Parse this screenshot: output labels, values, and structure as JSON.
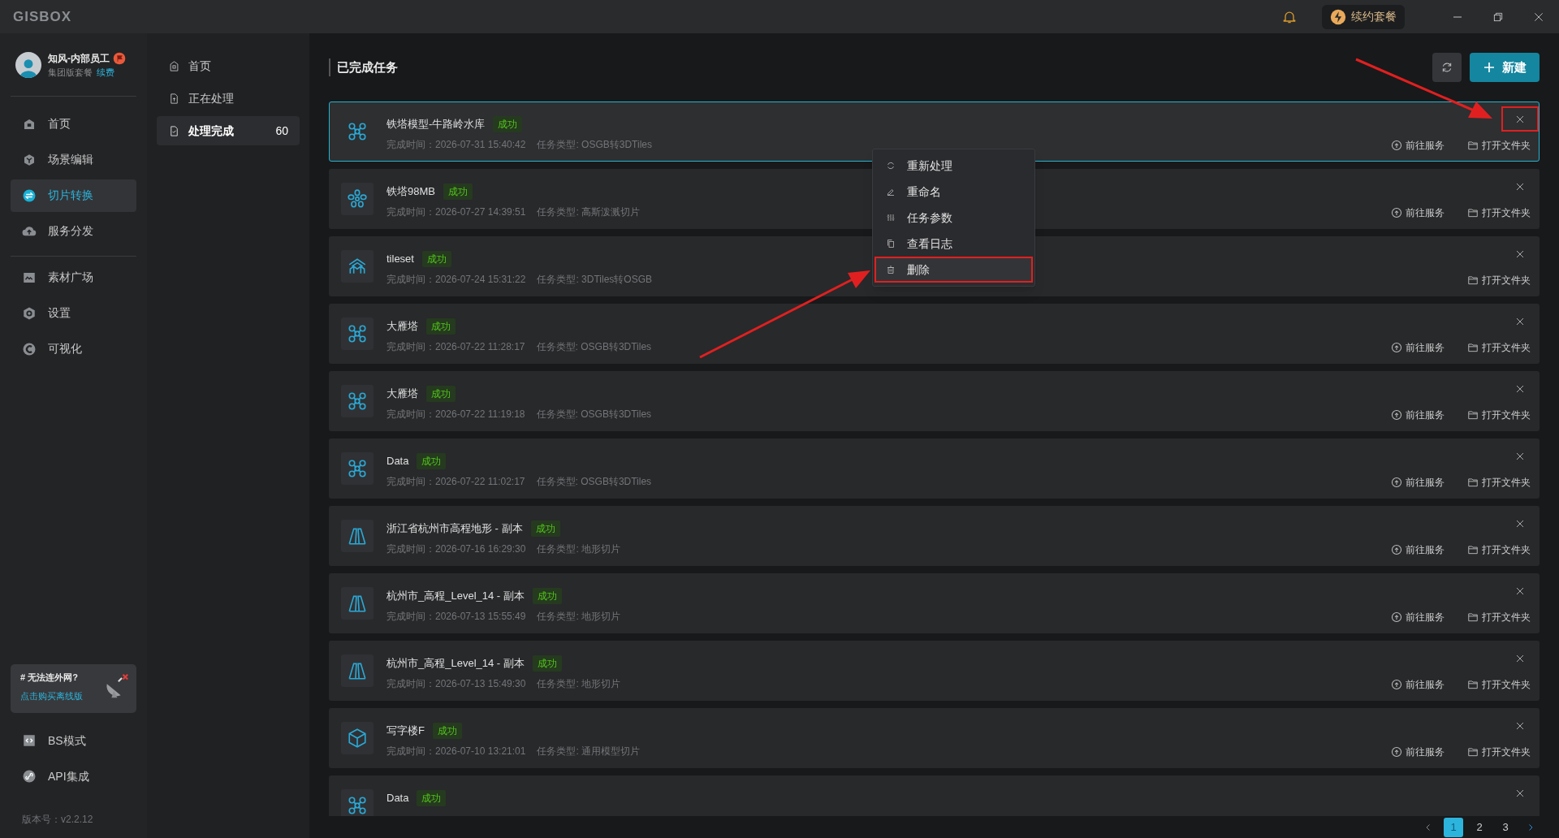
{
  "app": {
    "logo": "GISBOX",
    "renew_button": "续约套餐"
  },
  "user": {
    "name": "知风-内部员工",
    "plan": "集团版套餐",
    "renew_link": "续费"
  },
  "nav_groups": [
    {
      "items": [
        {
          "label": "首页",
          "selected": false
        },
        {
          "label": "场景编辑",
          "selected": false
        },
        {
          "label": "切片转换",
          "selected": true
        },
        {
          "label": "服务分发",
          "selected": false
        }
      ]
    },
    {
      "items": [
        {
          "label": "素材广场",
          "selected": false
        },
        {
          "label": "设置",
          "selected": false
        },
        {
          "label": "可视化",
          "selected": false
        }
      ]
    }
  ],
  "promo": {
    "title": "# 无法连外网?",
    "link": "点击购买离线版"
  },
  "bottom_nav": [
    {
      "label": "BS模式"
    },
    {
      "label": "API集成"
    }
  ],
  "version": "版本号：v2.2.12",
  "sub_nav": [
    {
      "label": "首页",
      "selected": false
    },
    {
      "label": "正在处理",
      "selected": false
    },
    {
      "label": "处理完成",
      "selected": true,
      "count": "60"
    }
  ],
  "page_title": "已完成任务",
  "new_button": "新建",
  "tasks": [
    {
      "name": "铁塔模型-牛路岭水库",
      "status": "成功",
      "time": "完成时间：2026-07-31 15:40:42",
      "type": "任务类型: OSGB转3DTiles",
      "kind": "drone",
      "selected": true,
      "close_highlighted": true,
      "actions": [
        "前往服务",
        "打开文件夹"
      ]
    },
    {
      "name": "铁塔98MB",
      "status": "成功",
      "time": "完成时间：2026-07-27 14:39:51",
      "type": "任务类型: 高斯泼溅切片",
      "kind": "splat",
      "selected": false,
      "close_highlighted": false,
      "actions": [
        "前往服务",
        "打开文件夹"
      ]
    },
    {
      "name": "tileset",
      "status": "成功",
      "time": "完成时间：2026-07-24 15:31:22",
      "type": "任务类型: 3DTiles转OSGB",
      "kind": "tiles",
      "selected": false,
      "close_highlighted": false,
      "actions": [
        "打开文件夹"
      ]
    },
    {
      "name": "大雁塔",
      "status": "成功",
      "time": "完成时间：2026-07-22 11:28:17",
      "type": "任务类型: OSGB转3DTiles",
      "kind": "drone",
      "selected": false,
      "close_highlighted": false,
      "actions": [
        "前往服务",
        "打开文件夹"
      ]
    },
    {
      "name": "大雁塔",
      "status": "成功",
      "time": "完成时间：2026-07-22 11:19:18",
      "type": "任务类型: OSGB转3DTiles",
      "kind": "drone",
      "selected": false,
      "close_highlighted": false,
      "actions": [
        "前往服务",
        "打开文件夹"
      ]
    },
    {
      "name": "Data",
      "status": "成功",
      "time": "完成时间：2026-07-22 11:02:17",
      "type": "任务类型: OSGB转3DTiles",
      "kind": "drone",
      "selected": false,
      "close_highlighted": false,
      "actions": [
        "前往服务",
        "打开文件夹"
      ]
    },
    {
      "name": "浙江省杭州市高程地形 - 副本",
      "status": "成功",
      "time": "完成时间：2026-07-16 16:29:30",
      "type": "任务类型: 地形切片",
      "kind": "terrain",
      "selected": false,
      "close_highlighted": false,
      "actions": [
        "前往服务",
        "打开文件夹"
      ]
    },
    {
      "name": "杭州市_高程_Level_14 - 副本",
      "status": "成功",
      "time": "完成时间：2026-07-13 15:55:49",
      "type": "任务类型: 地形切片",
      "kind": "terrain",
      "selected": false,
      "close_highlighted": false,
      "actions": [
        "前往服务",
        "打开文件夹"
      ]
    },
    {
      "name": "杭州市_高程_Level_14 - 副本",
      "status": "成功",
      "time": "完成时间：2026-07-13 15:49:30",
      "type": "任务类型: 地形切片",
      "kind": "terrain",
      "selected": false,
      "close_highlighted": false,
      "actions": [
        "前往服务",
        "打开文件夹"
      ]
    },
    {
      "name": "写字楼F",
      "status": "成功",
      "time": "完成时间：2026-07-10 13:21:01",
      "type": "任务类型: 通用模型切片",
      "kind": "box",
      "selected": false,
      "close_highlighted": false,
      "actions": [
        "前往服务",
        "打开文件夹"
      ]
    },
    {
      "name": "Data",
      "status": "成功",
      "kind": "drone",
      "selected": false,
      "close_highlighted": false
    }
  ],
  "context_menu": [
    {
      "label": "重新处理",
      "highlighted": false
    },
    {
      "label": "重命名",
      "highlighted": false
    },
    {
      "label": "任务参数",
      "highlighted": false
    },
    {
      "label": "查看日志",
      "highlighted": false
    },
    {
      "label": "删除",
      "highlighted": true
    }
  ],
  "pagination": {
    "pages": [
      {
        "label": "1",
        "selected": true
      },
      {
        "label": "2",
        "selected": false
      },
      {
        "label": "3",
        "selected": false
      }
    ]
  }
}
